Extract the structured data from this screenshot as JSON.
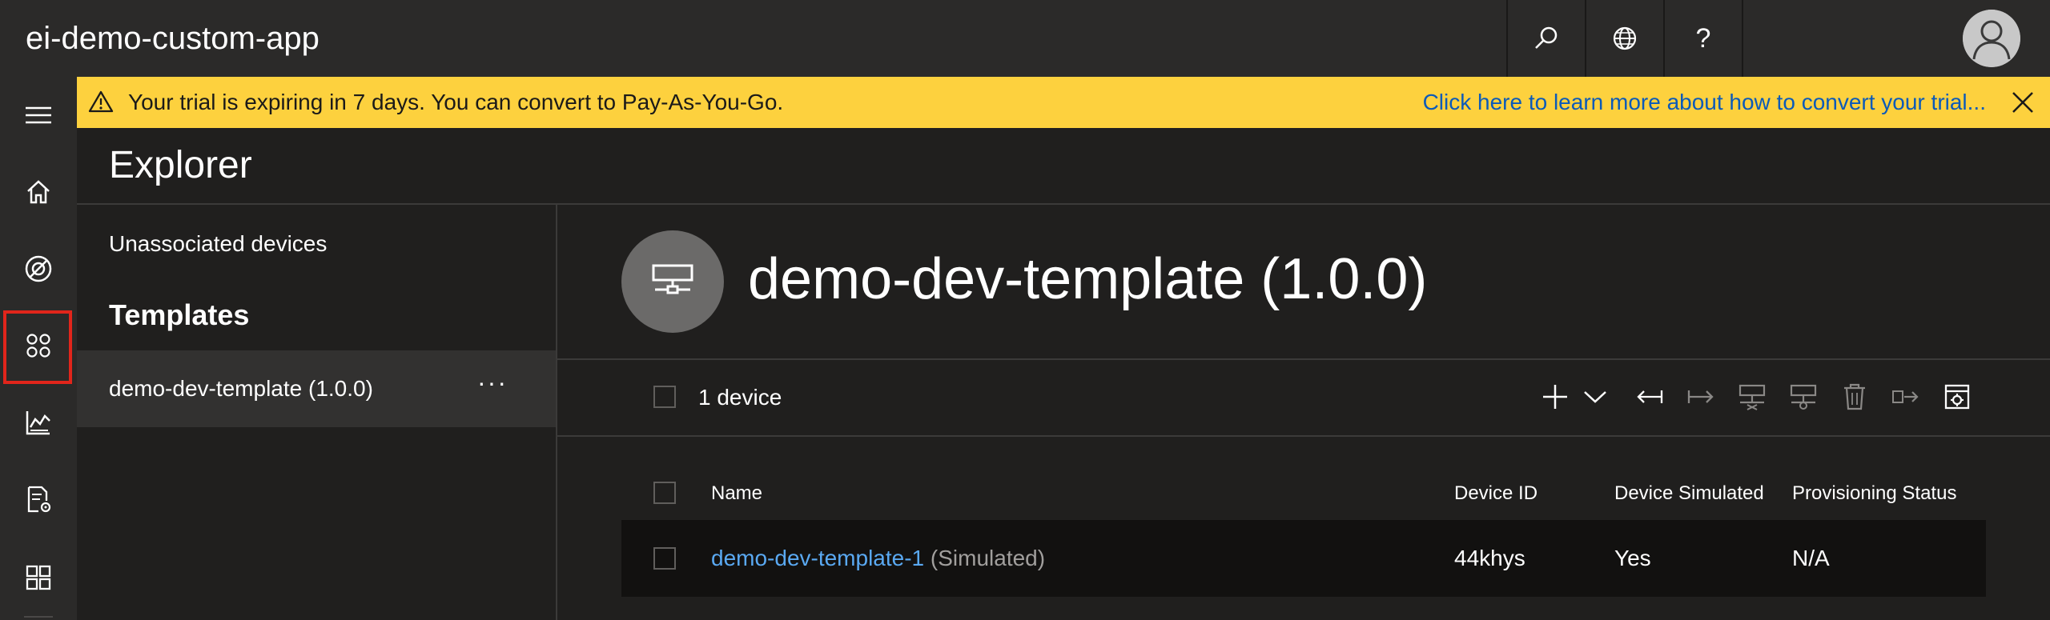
{
  "app": {
    "title": "ei-demo-custom-app"
  },
  "topbar": {
    "icons": [
      "search-icon",
      "globe-icon",
      "help-icon"
    ],
    "help_label": "?"
  },
  "rail": {
    "items": [
      "hamburger-menu-icon",
      "home-icon",
      "device-explorer-icon",
      "device-groups-icon",
      "analytics-icon",
      "jobs-icon",
      "dashboard-icon"
    ],
    "selected": "device-explorer-icon",
    "selected_outline_color": "#e1251b"
  },
  "banner": {
    "text": "Your trial is expiring in 7 days. You can convert to Pay-As-You-Go.",
    "link": "Click here to learn more about how to convert your trial...",
    "bg_color": "#fdd13e",
    "link_color": "#0b5ab9"
  },
  "explorer": {
    "title": "Explorer",
    "unassociated": "Unassociated devices",
    "templates_heading": "Templates",
    "template_item": "demo-dev-template (1.0.0)",
    "template_item_more": "···"
  },
  "main": {
    "template_title": "demo-dev-template (1.0.0)",
    "device_count": "1 device",
    "toolbar_icons": [
      "add-icon",
      "chevron-down-icon",
      "import-icon",
      "export-icon",
      "block-device-icon",
      "unblock-device-icon",
      "delete-icon",
      "migrate-icon",
      "settings-icon"
    ]
  },
  "table": {
    "headers": [
      "Name",
      "Device ID",
      "Device Simulated",
      "Provisioning Status"
    ],
    "rows": [
      {
        "name": "demo-dev-template-1",
        "suffix": "(Simulated)",
        "device_id": "44khys",
        "simulated": "Yes",
        "status": "N/A"
      }
    ]
  }
}
